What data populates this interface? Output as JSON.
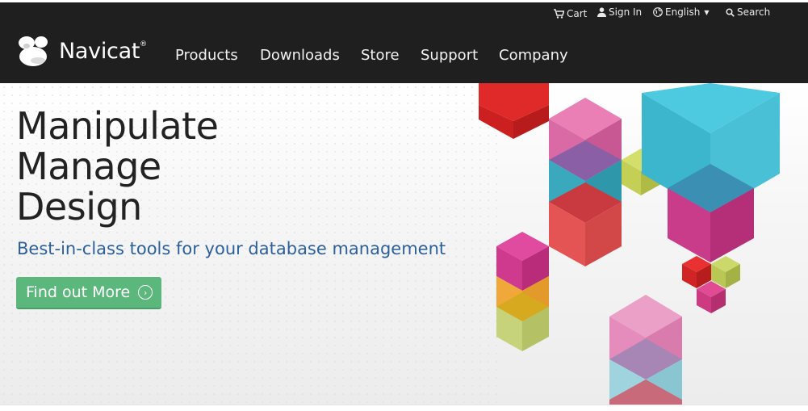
{
  "utility": {
    "cart": "Cart",
    "sign_in": "Sign In",
    "language": "English",
    "search": "Search"
  },
  "brand": {
    "name": "Navicat",
    "mark": "®"
  },
  "nav": [
    {
      "label": "Products"
    },
    {
      "label": "Downloads"
    },
    {
      "label": "Store"
    },
    {
      "label": "Support"
    },
    {
      "label": "Company"
    }
  ],
  "hero": {
    "headline": [
      "Manipulate",
      "Manage",
      "Design"
    ],
    "tagline": "Best-in-class tools for your database management",
    "cta": "Find out More"
  },
  "icons": {
    "cart": "cart-icon",
    "user": "user-icon",
    "globe": "globe-icon",
    "search": "search-icon",
    "cta_arrow": "chevron-right-icon"
  },
  "colors": {
    "header_bg": "#1f1f1f",
    "tagline": "#2b5f9e",
    "cta_bg": "#5cb77d"
  }
}
